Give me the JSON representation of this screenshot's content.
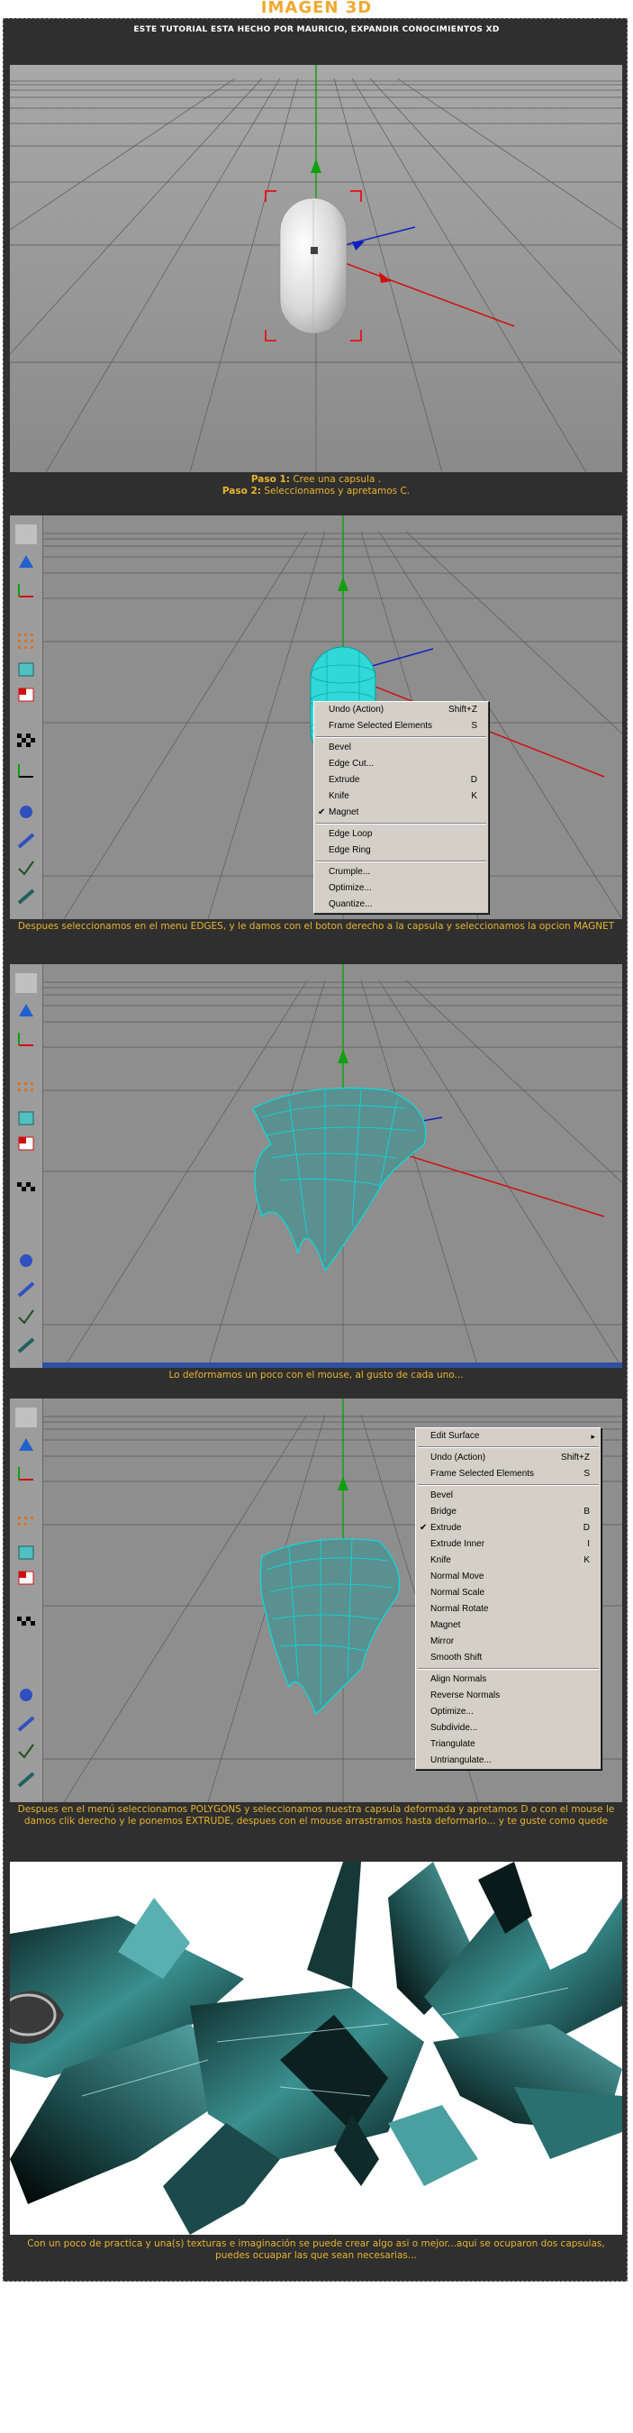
{
  "page": {
    "title": "IMAGEN 3D",
    "credit": "ESTE TUTORIAL ESTA HECHO POR MAURICIO, EXPANDIR CONOCIMIENTOS XD"
  },
  "steps": {
    "step1_label": "Paso 1:",
    "step1_text": " Cree una capsula .",
    "step2_label": "Paso 2:",
    "step2_text": " Seleccionamos y apretamos C.",
    "caption2": "Despues seleccionamos en el menu EDGES, y le damos con el boton derecho a la capsula y seleccionamos la opcion MAGNET",
    "caption3": "Lo deformamos un poco con el mouse, al gusto de cada uno...",
    "caption4": "Despues en el menú seleccionamos POLYGONS y seleccionamos nuestra capsula deformada y apretamos D o con el mouse le damos clik derecho y le ponemos EXTRUDE, despues con el mouse arrastramos hasta deformarlo... y te guste como quede",
    "caption5": "Con un poco de practica y una(s) texturas e imaginación se puede crear algo asi o mejor...aqui se ocuparon dos capsulas, puedes ocuapar las que sean necesarias..."
  },
  "menu1": {
    "items": [
      {
        "label": "Undo (Action)",
        "shortcut": "Shift+Z"
      },
      {
        "label": "Frame Selected Elements",
        "shortcut": "S"
      },
      {
        "label": "Bevel",
        "shortcut": ""
      },
      {
        "label": "Edge Cut...",
        "shortcut": ""
      },
      {
        "label": "Extrude",
        "shortcut": "D"
      },
      {
        "label": "Knife",
        "shortcut": "K"
      },
      {
        "label": "Magnet",
        "shortcut": "",
        "checked": "✔"
      },
      {
        "label": "Edge Loop",
        "shortcut": ""
      },
      {
        "label": "Edge Ring",
        "shortcut": ""
      },
      {
        "label": "Crumple...",
        "shortcut": ""
      },
      {
        "label": "Optimize...",
        "shortcut": ""
      },
      {
        "label": "Quantize...",
        "shortcut": ""
      }
    ]
  },
  "menu2": {
    "items": [
      {
        "label": "Edit Surface",
        "arrow": "▸"
      },
      {
        "label": "Undo (Action)",
        "shortcut": "Shift+Z"
      },
      {
        "label": "Frame Selected Elements",
        "shortcut": "S"
      },
      {
        "label": "Bevel",
        "shortcut": ""
      },
      {
        "label": "Bridge",
        "shortcut": "B"
      },
      {
        "label": "Extrude",
        "shortcut": "D",
        "checked": "✔"
      },
      {
        "label": "Extrude Inner",
        "shortcut": "I"
      },
      {
        "label": "Knife",
        "shortcut": "K"
      },
      {
        "label": "Normal Move",
        "shortcut": ""
      },
      {
        "label": "Normal Scale",
        "shortcut": ""
      },
      {
        "label": "Normal Rotate",
        "shortcut": ""
      },
      {
        "label": "Magnet",
        "shortcut": ""
      },
      {
        "label": "Mirror",
        "shortcut": ""
      },
      {
        "label": "Smooth Shift",
        "shortcut": ""
      },
      {
        "label": "Align Normals",
        "shortcut": ""
      },
      {
        "label": "Reverse Normals",
        "shortcut": ""
      },
      {
        "label": "Optimize...",
        "shortcut": ""
      },
      {
        "label": "Subdivide...",
        "shortcut": ""
      },
      {
        "label": "Triangulate",
        "shortcut": ""
      },
      {
        "label": "Untriangulate...",
        "shortcut": ""
      }
    ]
  },
  "colors": {
    "title": "#f0a830",
    "caption": "#e8b430",
    "panel": "#2f2f2f",
    "viewport": "#8c8c8c",
    "mesh": "#00e0e0",
    "axis_x": "#d01010",
    "axis_y": "#10a010",
    "axis_z": "#1020c0"
  }
}
